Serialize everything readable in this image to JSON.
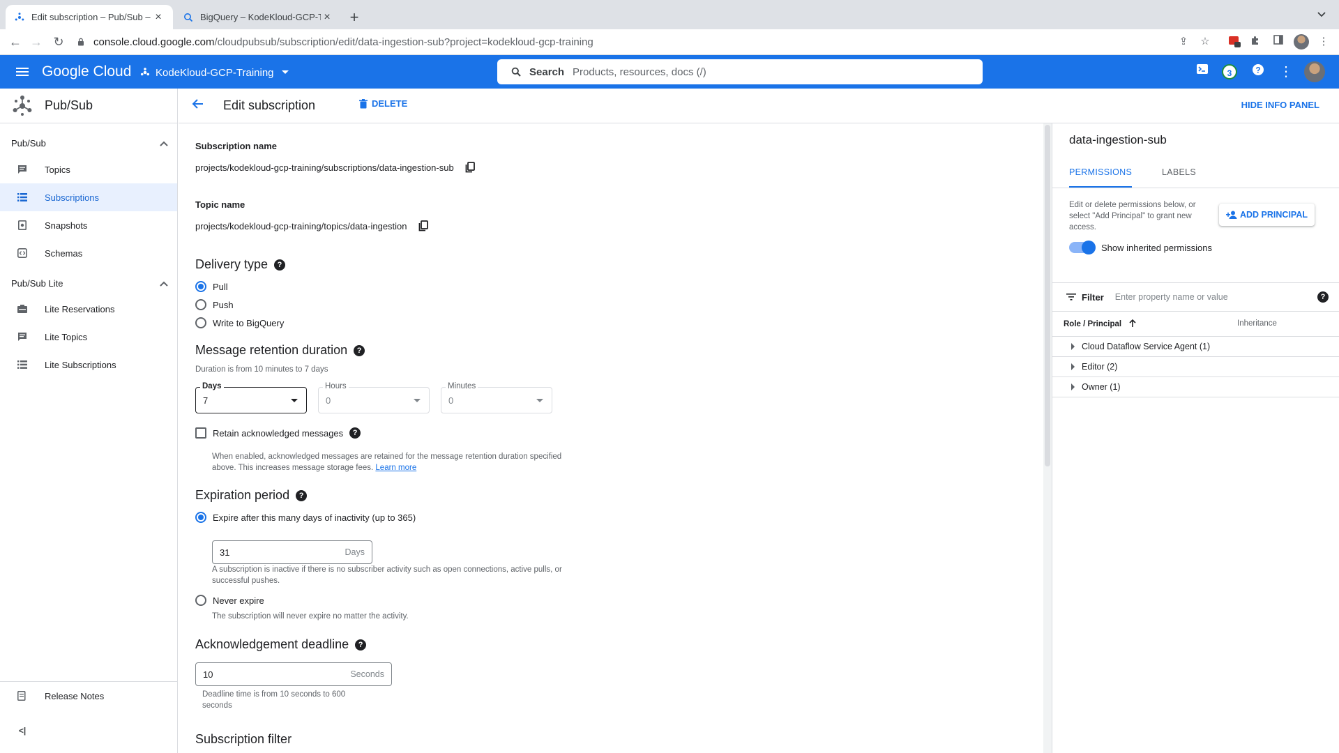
{
  "browser": {
    "tabs": [
      {
        "label": "Edit subscription – Pub/Sub – K",
        "active": true
      },
      {
        "label": "BigQuery – KodeKloud-GCP-Tr",
        "active": false
      }
    ],
    "url_host": "console.cloud.google.com",
    "url_path": "/cloudpubsub/subscription/edit/data-ingestion-sub?project=kodekloud-gcp-training",
    "ext_badge": "3"
  },
  "gcbar": {
    "logo": "Google Cloud",
    "project": "KodeKloud-GCP-Training",
    "search_label": "Search",
    "search_placeholder": "Products, resources, docs (/)",
    "notification_count": "3"
  },
  "sidebar": {
    "product": "Pub/Sub",
    "sections": [
      {
        "label": "Pub/Sub",
        "items": [
          "Topics",
          "Subscriptions",
          "Snapshots",
          "Schemas"
        ]
      },
      {
        "label": "Pub/Sub Lite",
        "items": [
          "Lite Reservations",
          "Lite Topics",
          "Lite Subscriptions"
        ]
      }
    ],
    "active_item": "Subscriptions",
    "release_notes": "Release Notes",
    "collapse_label": "<|"
  },
  "header": {
    "title": "Edit subscription",
    "delete": "DELETE",
    "hide_info": "HIDE INFO PANEL"
  },
  "form": {
    "subscription_name_label": "Subscription name",
    "subscription_name": "projects/kodekloud-gcp-training/subscriptions/data-ingestion-sub",
    "topic_name_label": "Topic name",
    "topic_name": "projects/kodekloud-gcp-training/topics/data-ingestion",
    "delivery_type": {
      "title": "Delivery type",
      "options": [
        "Pull",
        "Push",
        "Write to BigQuery"
      ],
      "selected": "Pull"
    },
    "retention": {
      "title": "Message retention duration",
      "hint": "Duration is from 10 minutes to 7 days",
      "days_label": "Days",
      "days_value": "7",
      "hours_label": "Hours",
      "hours_value": "0",
      "minutes_label": "Minutes",
      "minutes_value": "0",
      "retain_acked_label": "Retain acknowledged messages",
      "retain_acked_checked": false,
      "retain_hint": "When enabled, acknowledged messages are retained for the message retention duration specified above. This increases message storage fees.",
      "learn_more": "Learn more"
    },
    "expiration": {
      "title": "Expiration period",
      "expire_option": "Expire after this many days of inactivity (up to 365)",
      "days_value": "31",
      "days_suffix": "Days",
      "inactive_hint": "A subscription is inactive if there is no subscriber activity such as open connections, active pulls, or successful pushes.",
      "never_option": "Never expire",
      "never_hint": "The subscription will never expire no matter the activity.",
      "selected": "expire"
    },
    "ack": {
      "title": "Acknowledgement deadline",
      "value": "10",
      "suffix": "Seconds",
      "hint": "Deadline time is from 10 seconds to 600 seconds"
    },
    "filter_title": "Subscription filter"
  },
  "info_panel": {
    "title": "data-ingestion-sub",
    "tabs": [
      "PERMISSIONS",
      "LABELS"
    ],
    "active_tab": "PERMISSIONS",
    "description": "Edit or delete permissions below, or select \"Add Principal\" to grant new access.",
    "add_principal": "ADD PRINCIPAL",
    "show_inherited": "Show inherited permissions",
    "show_inherited_on": true,
    "filter_label": "Filter",
    "filter_placeholder": "Enter property name or value",
    "col_role": "Role / Principal",
    "col_inheritance": "Inheritance",
    "rows": [
      "Cloud Dataflow Service Agent (1)",
      "Editor (2)",
      "Owner (1)"
    ]
  },
  "colors": {
    "brand_blue": "#1a73e8",
    "active_nav_bg": "#e8f0fe",
    "text": "#202124",
    "secondary_text": "#5f6368"
  }
}
